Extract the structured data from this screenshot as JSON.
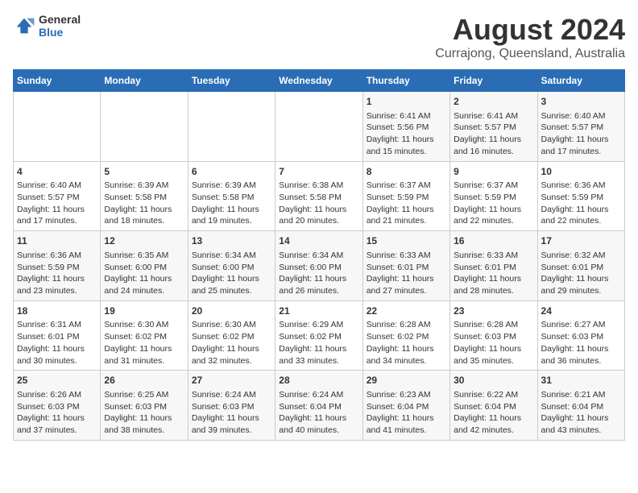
{
  "header": {
    "logo_line1": "General",
    "logo_line2": "Blue",
    "title": "August 2024",
    "subtitle": "Currajong, Queensland, Australia"
  },
  "days_of_week": [
    "Sunday",
    "Monday",
    "Tuesday",
    "Wednesday",
    "Thursday",
    "Friday",
    "Saturday"
  ],
  "weeks": [
    [
      {
        "day": "",
        "content": ""
      },
      {
        "day": "",
        "content": ""
      },
      {
        "day": "",
        "content": ""
      },
      {
        "day": "",
        "content": ""
      },
      {
        "day": "1",
        "content": "Sunrise: 6:41 AM\nSunset: 5:56 PM\nDaylight: 11 hours and 15 minutes."
      },
      {
        "day": "2",
        "content": "Sunrise: 6:41 AM\nSunset: 5:57 PM\nDaylight: 11 hours and 16 minutes."
      },
      {
        "day": "3",
        "content": "Sunrise: 6:40 AM\nSunset: 5:57 PM\nDaylight: 11 hours and 17 minutes."
      }
    ],
    [
      {
        "day": "4",
        "content": "Sunrise: 6:40 AM\nSunset: 5:57 PM\nDaylight: 11 hours and 17 minutes."
      },
      {
        "day": "5",
        "content": "Sunrise: 6:39 AM\nSunset: 5:58 PM\nDaylight: 11 hours and 18 minutes."
      },
      {
        "day": "6",
        "content": "Sunrise: 6:39 AM\nSunset: 5:58 PM\nDaylight: 11 hours and 19 minutes."
      },
      {
        "day": "7",
        "content": "Sunrise: 6:38 AM\nSunset: 5:58 PM\nDaylight: 11 hours and 20 minutes."
      },
      {
        "day": "8",
        "content": "Sunrise: 6:37 AM\nSunset: 5:59 PM\nDaylight: 11 hours and 21 minutes."
      },
      {
        "day": "9",
        "content": "Sunrise: 6:37 AM\nSunset: 5:59 PM\nDaylight: 11 hours and 22 minutes."
      },
      {
        "day": "10",
        "content": "Sunrise: 6:36 AM\nSunset: 5:59 PM\nDaylight: 11 hours and 22 minutes."
      }
    ],
    [
      {
        "day": "11",
        "content": "Sunrise: 6:36 AM\nSunset: 5:59 PM\nDaylight: 11 hours and 23 minutes."
      },
      {
        "day": "12",
        "content": "Sunrise: 6:35 AM\nSunset: 6:00 PM\nDaylight: 11 hours and 24 minutes."
      },
      {
        "day": "13",
        "content": "Sunrise: 6:34 AM\nSunset: 6:00 PM\nDaylight: 11 hours and 25 minutes."
      },
      {
        "day": "14",
        "content": "Sunrise: 6:34 AM\nSunset: 6:00 PM\nDaylight: 11 hours and 26 minutes."
      },
      {
        "day": "15",
        "content": "Sunrise: 6:33 AM\nSunset: 6:01 PM\nDaylight: 11 hours and 27 minutes."
      },
      {
        "day": "16",
        "content": "Sunrise: 6:33 AM\nSunset: 6:01 PM\nDaylight: 11 hours and 28 minutes."
      },
      {
        "day": "17",
        "content": "Sunrise: 6:32 AM\nSunset: 6:01 PM\nDaylight: 11 hours and 29 minutes."
      }
    ],
    [
      {
        "day": "18",
        "content": "Sunrise: 6:31 AM\nSunset: 6:01 PM\nDaylight: 11 hours and 30 minutes."
      },
      {
        "day": "19",
        "content": "Sunrise: 6:30 AM\nSunset: 6:02 PM\nDaylight: 11 hours and 31 minutes."
      },
      {
        "day": "20",
        "content": "Sunrise: 6:30 AM\nSunset: 6:02 PM\nDaylight: 11 hours and 32 minutes."
      },
      {
        "day": "21",
        "content": "Sunrise: 6:29 AM\nSunset: 6:02 PM\nDaylight: 11 hours and 33 minutes."
      },
      {
        "day": "22",
        "content": "Sunrise: 6:28 AM\nSunset: 6:02 PM\nDaylight: 11 hours and 34 minutes."
      },
      {
        "day": "23",
        "content": "Sunrise: 6:28 AM\nSunset: 6:03 PM\nDaylight: 11 hours and 35 minutes."
      },
      {
        "day": "24",
        "content": "Sunrise: 6:27 AM\nSunset: 6:03 PM\nDaylight: 11 hours and 36 minutes."
      }
    ],
    [
      {
        "day": "25",
        "content": "Sunrise: 6:26 AM\nSunset: 6:03 PM\nDaylight: 11 hours and 37 minutes."
      },
      {
        "day": "26",
        "content": "Sunrise: 6:25 AM\nSunset: 6:03 PM\nDaylight: 11 hours and 38 minutes."
      },
      {
        "day": "27",
        "content": "Sunrise: 6:24 AM\nSunset: 6:03 PM\nDaylight: 11 hours and 39 minutes."
      },
      {
        "day": "28",
        "content": "Sunrise: 6:24 AM\nSunset: 6:04 PM\nDaylight: 11 hours and 40 minutes."
      },
      {
        "day": "29",
        "content": "Sunrise: 6:23 AM\nSunset: 6:04 PM\nDaylight: 11 hours and 41 minutes."
      },
      {
        "day": "30",
        "content": "Sunrise: 6:22 AM\nSunset: 6:04 PM\nDaylight: 11 hours and 42 minutes."
      },
      {
        "day": "31",
        "content": "Sunrise: 6:21 AM\nSunset: 6:04 PM\nDaylight: 11 hours and 43 minutes."
      }
    ]
  ]
}
